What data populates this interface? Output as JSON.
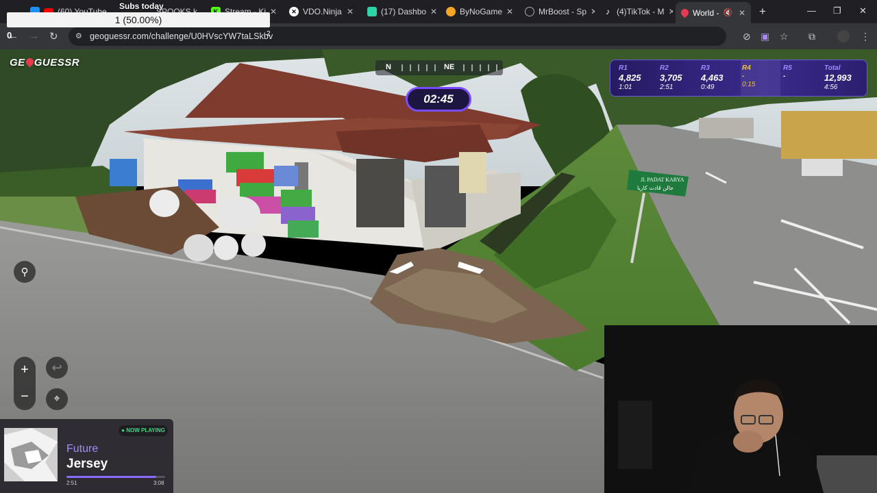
{
  "browser": {
    "tabs": [
      {
        "label": "(60) YouTube",
        "icon": "youtube-icon",
        "color": "#ff0000"
      },
      {
        "label": "SPOOKS k",
        "icon": "spooks-icon",
        "color": "#ff4444"
      },
      {
        "label": "Stream - Ki",
        "icon": "kick-icon",
        "color": "#53fc18"
      },
      {
        "label": "VDO.Ninja",
        "icon": "vdo-ninja-icon",
        "color": "#ffffff"
      },
      {
        "label": "(17) Dashbo",
        "icon": "dashboard-icon",
        "color": "#2dd4a8"
      },
      {
        "label": "ByNoGame",
        "icon": "bynogame-icon",
        "color": "#f5a524"
      },
      {
        "label": "MrBoost - Sp",
        "icon": "globe-icon",
        "color": "#aaaaaa"
      },
      {
        "label": "(4)TikTok - M",
        "icon": "tiktok-icon",
        "color": "#ffffff"
      },
      {
        "label": "World - ",
        "icon": "geoguessr-pin-icon",
        "color": "#e43b4f"
      }
    ],
    "url": "geoguessr.com/challenge/U0HVscYW7taLSkbv"
  },
  "overlay": {
    "subs_title": "Subs today",
    "subs_value": "1 (50.00%)",
    "subs_zero": "0",
    "subs_two": "2"
  },
  "game": {
    "logo_left": "GE",
    "logo_right": "GUESSR",
    "compass": {
      "n": "N",
      "ne": "NE"
    },
    "timer": "02:45",
    "rounds": [
      {
        "label": "R1",
        "score": "4,825",
        "time": "1:01"
      },
      {
        "label": "R2",
        "score": "3,705",
        "time": "2:51"
      },
      {
        "label": "R3",
        "score": "4,463",
        "time": "0:49"
      },
      {
        "label": "R4",
        "score": "-",
        "time": "0:15"
      },
      {
        "label": "R5",
        "score": "-",
        "time": ""
      },
      {
        "label": "Total",
        "score": "12,993",
        "time": "4:56"
      }
    ],
    "active_round": "R4",
    "street_sign_line1": "Jl. PADAT KARYA",
    "street_sign_line2": "جالن ڤادت کاريا",
    "zoom_in": "+",
    "zoom_out": "−",
    "undo": "↩"
  },
  "now_playing": {
    "badge": "● NOW PLAYING",
    "artist": "Future",
    "title": "Jersey",
    "current": "2:51",
    "duration": "3:08",
    "progress": 0.91
  }
}
